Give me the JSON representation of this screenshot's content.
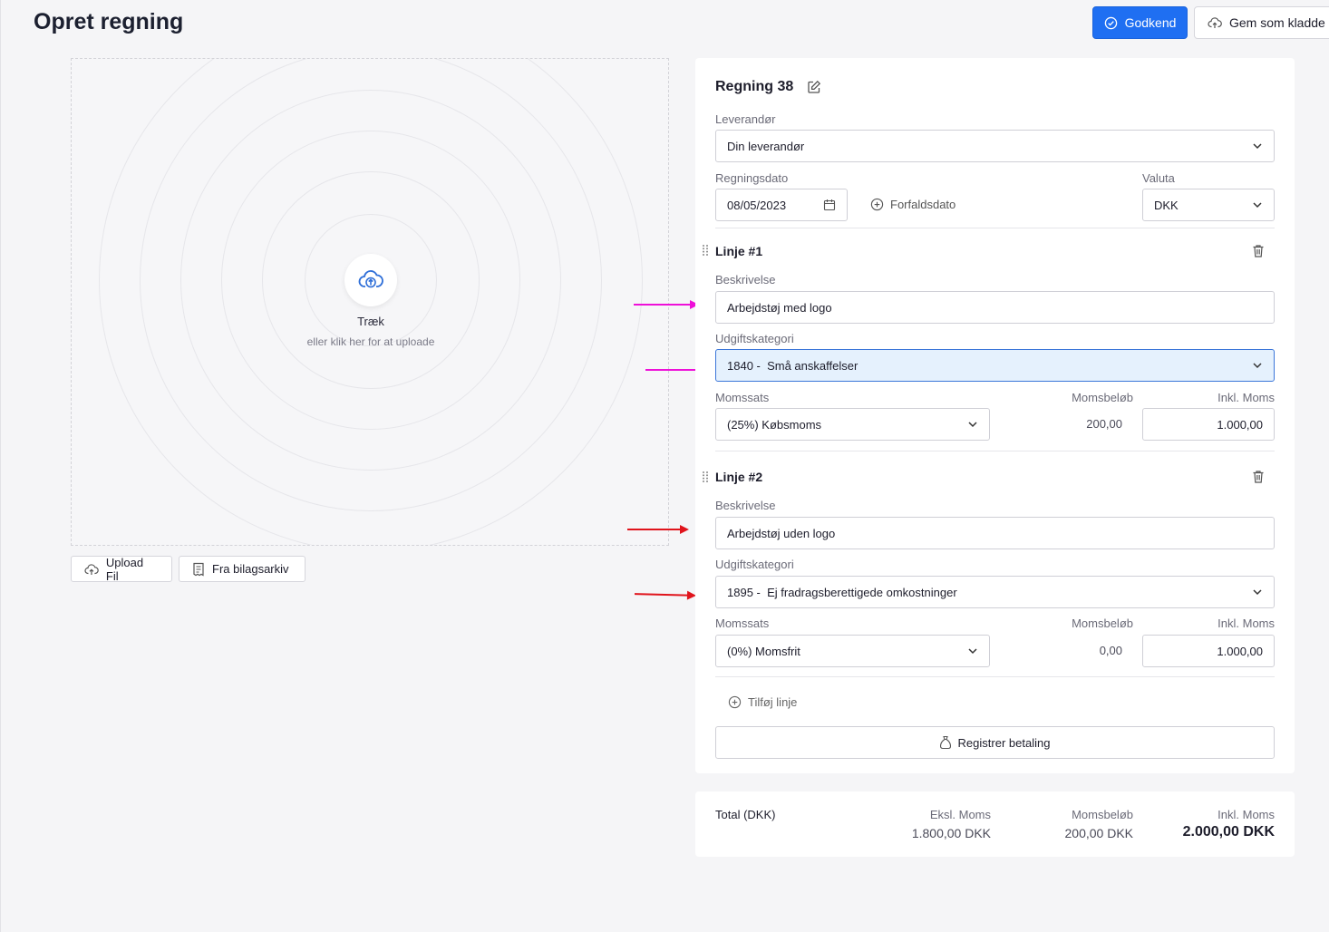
{
  "page": {
    "title": "Opret regning"
  },
  "header": {
    "approve_label": "Godkend",
    "draft_label": "Gem som kladde"
  },
  "dropzone": {
    "title": "Træk",
    "subtitle": "eller klik her for at uploade"
  },
  "upload": {
    "upload_file_label": "Upload Fil",
    "archive_label": "Fra bilagsarkiv"
  },
  "bill": {
    "title": "Regning 38",
    "supplier_label": "Leverandør",
    "supplier_value": "Din leverandør",
    "date_label": "Regningsdato",
    "date_value": "08/05/2023",
    "due_date_label": "Forfaldsdato",
    "currency_label": "Valuta",
    "currency_value": "DKK",
    "lines": [
      {
        "title": "Linje #1",
        "description_label": "Beskrivelse",
        "description_value": "Arbejdstøj med logo",
        "category_label": "Udgiftskategori",
        "category_value": "1840 -  Små anskaffelser",
        "vat_rate_label": "Momssats",
        "vat_rate_value": "(25%) Købsmoms",
        "vat_amount_label": "Momsbeløb",
        "vat_amount_value": "200,00",
        "incl_vat_label": "Inkl. Moms",
        "incl_vat_value": "1.000,00"
      },
      {
        "title": "Linje #2",
        "description_label": "Beskrivelse",
        "description_value": "Arbejdstøj uden logo",
        "category_label": "Udgiftskategori",
        "category_value": "1895 -  Ej fradragsberettigede omkostninger",
        "vat_rate_label": "Momssats",
        "vat_rate_value": "(0%) Momsfrit",
        "vat_amount_label": "Momsbeløb",
        "vat_amount_value": "0,00",
        "incl_vat_label": "Inkl. Moms",
        "incl_vat_value": "1.000,00"
      }
    ],
    "add_line_label": "Tilføj linje",
    "register_payment_label": "Registrer betaling"
  },
  "totals": {
    "label": "Total (DKK)",
    "excl_vat_label": "Eksl. Moms",
    "excl_vat_value": "1.800,00 DKK",
    "vat_label": "Momsbeløb",
    "vat_value": "200,00 DKK",
    "incl_vat_label": "Inkl. Moms",
    "incl_vat_value": "2.000,00 DKK"
  },
  "colors": {
    "primary": "#1f6ff2",
    "active_field_bg": "#e5f1fd",
    "annotation_magenta": "#ee10d8",
    "annotation_red": "#e0141c"
  }
}
